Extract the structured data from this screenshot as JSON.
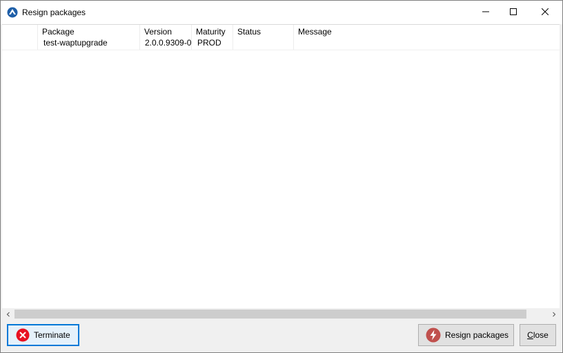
{
  "window": {
    "title": "Resign packages",
    "app_icon": "wapt-app-icon"
  },
  "grid": {
    "columns": [
      "Package",
      "Version",
      "Maturity",
      "Status",
      "Message"
    ],
    "rows": [
      {
        "package": "test-waptupgrade",
        "version": "2.0.0.9309-0",
        "maturity": "PROD",
        "status": "",
        "message": ""
      }
    ]
  },
  "buttons": {
    "terminate": "Terminate",
    "resign": "Resign packages",
    "close": "Close"
  },
  "colors": {
    "focus_border": "#0078d7",
    "terminate_icon": "#e81123",
    "resign_icon": "#c0504d"
  }
}
